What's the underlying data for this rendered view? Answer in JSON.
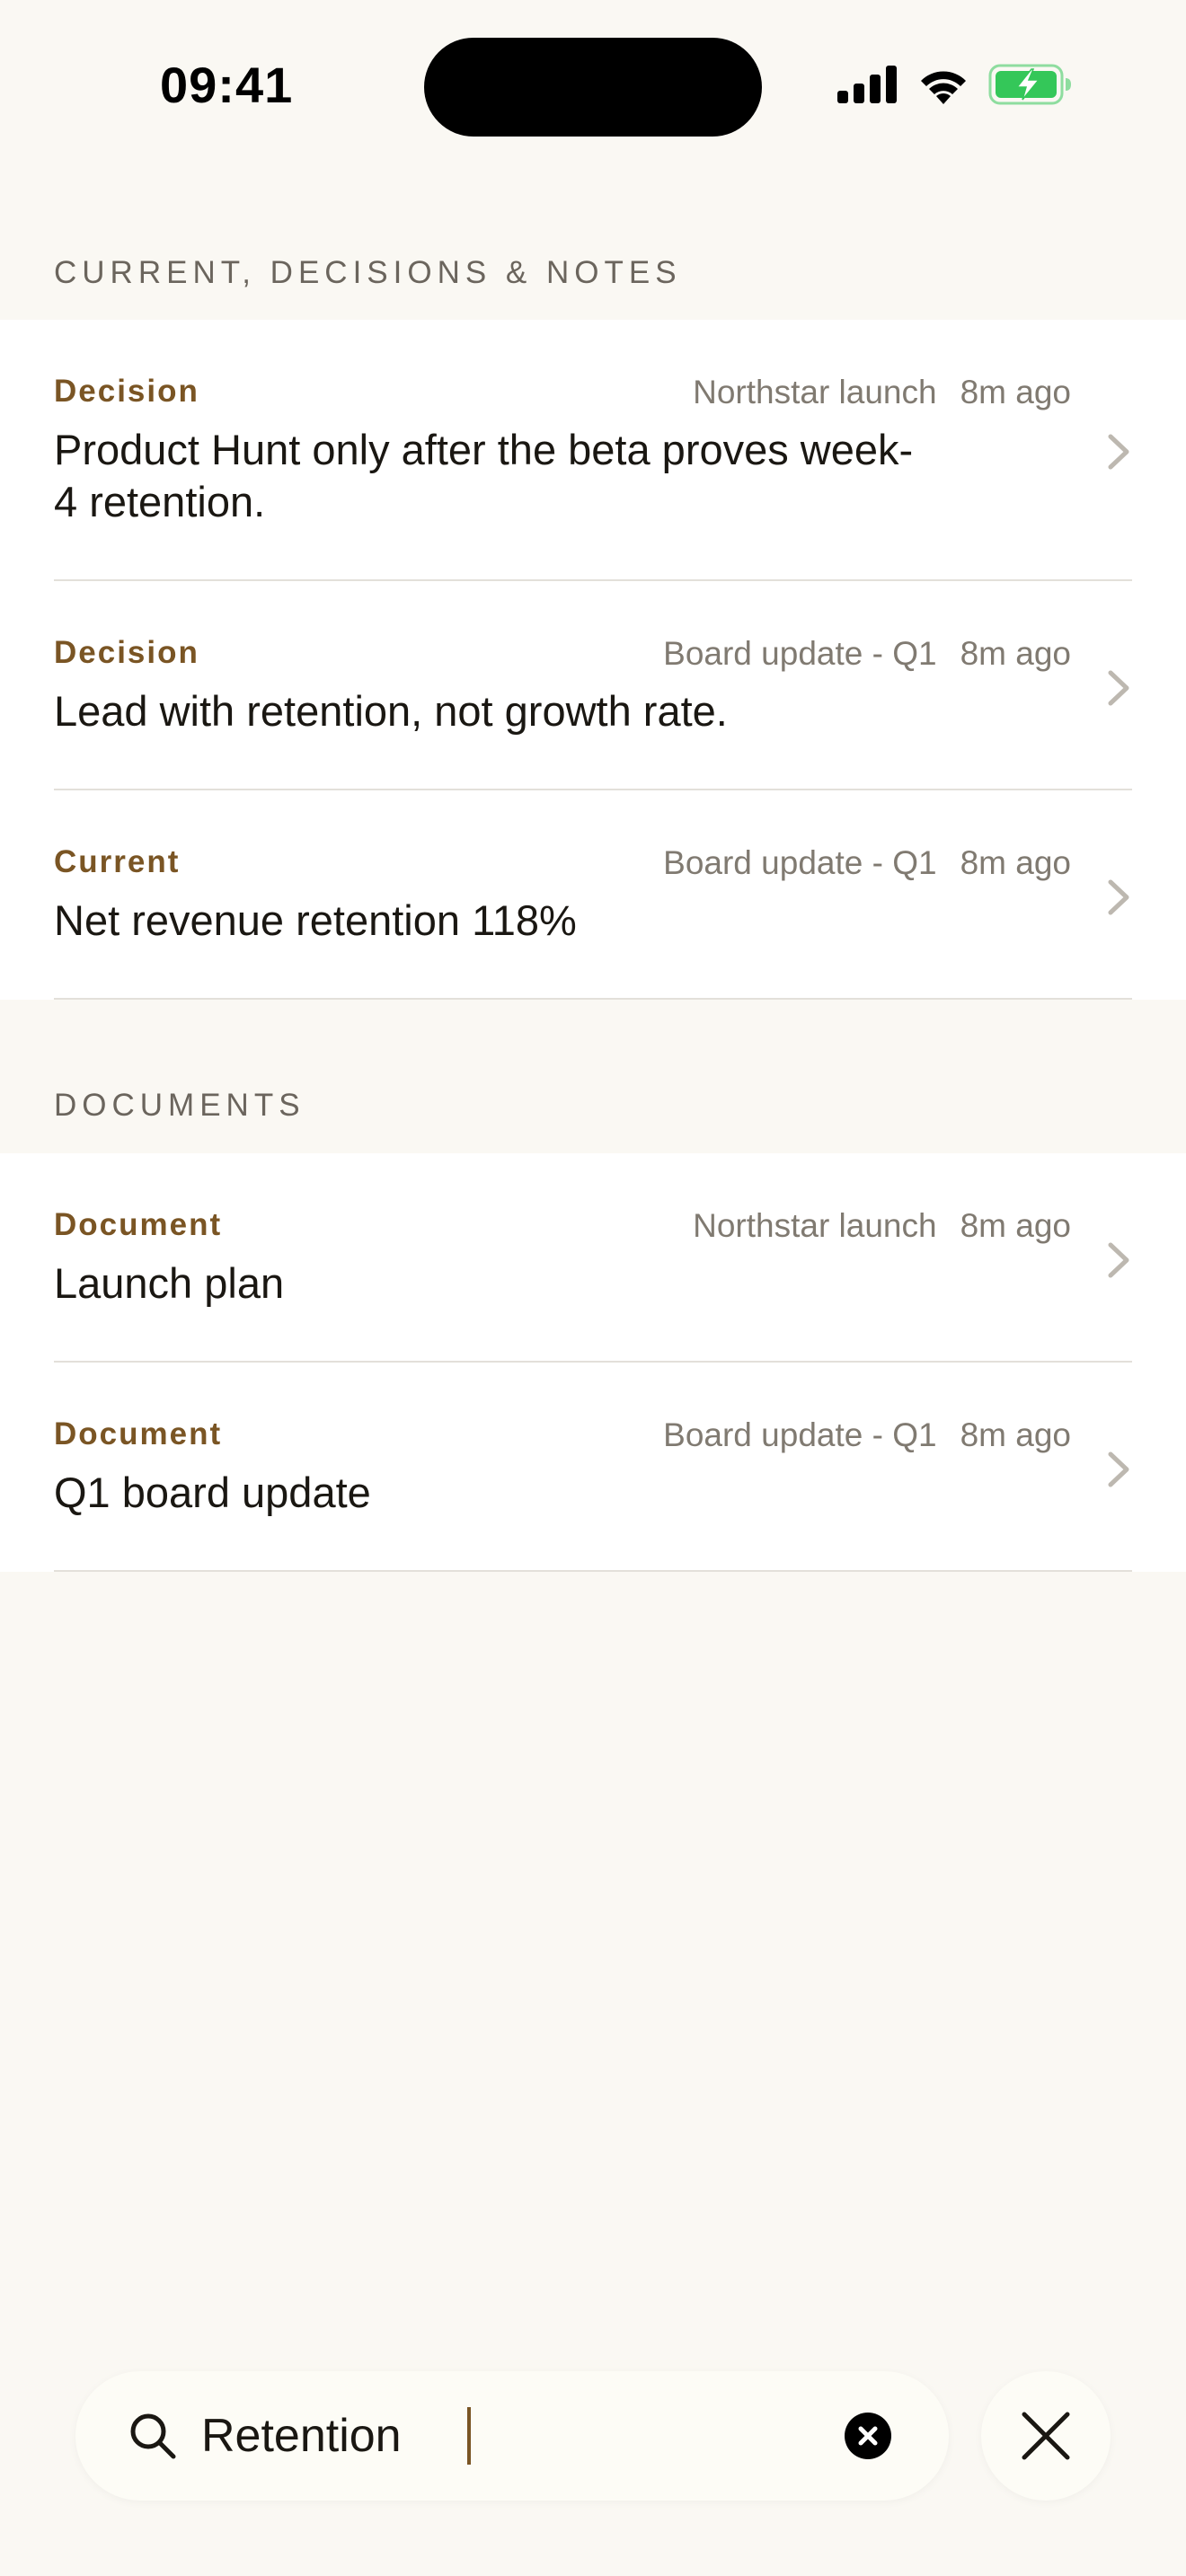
{
  "status_bar": {
    "time": "09:41",
    "icons": [
      "cellular-signal-icon",
      "wifi-icon",
      "battery-charging-icon"
    ],
    "battery_color": "#34c759"
  },
  "sections": [
    {
      "header": "CURRENT, DECISIONS & NOTES",
      "rows": [
        {
          "type": "Decision",
          "project": "Northstar launch",
          "time": "8m ago",
          "title": "Product Hunt only after the beta proves week-4 retention."
        },
        {
          "type": "Decision",
          "project": "Board update - Q1",
          "time": "8m ago",
          "title": "Lead with retention, not growth rate."
        },
        {
          "type": "Current",
          "project": "Board update - Q1",
          "time": "8m ago",
          "title": "Net revenue retention 118%"
        }
      ]
    },
    {
      "header": "DOCUMENTS",
      "rows": [
        {
          "type": "Document",
          "project": "Northstar launch",
          "time": "8m ago",
          "title": "Launch plan"
        },
        {
          "type": "Document",
          "project": "Board update - Q1",
          "time": "8m ago",
          "title": "Q1 board update"
        }
      ]
    }
  ],
  "search": {
    "value": "Retention",
    "icon": "search-icon",
    "clear_icon": "clear-circle-icon",
    "close_icon": "close-icon"
  },
  "colors": {
    "background": "#faf8f3",
    "accent": "#7a5524",
    "meta_text": "#807a71",
    "section_header": "#6b655d"
  }
}
